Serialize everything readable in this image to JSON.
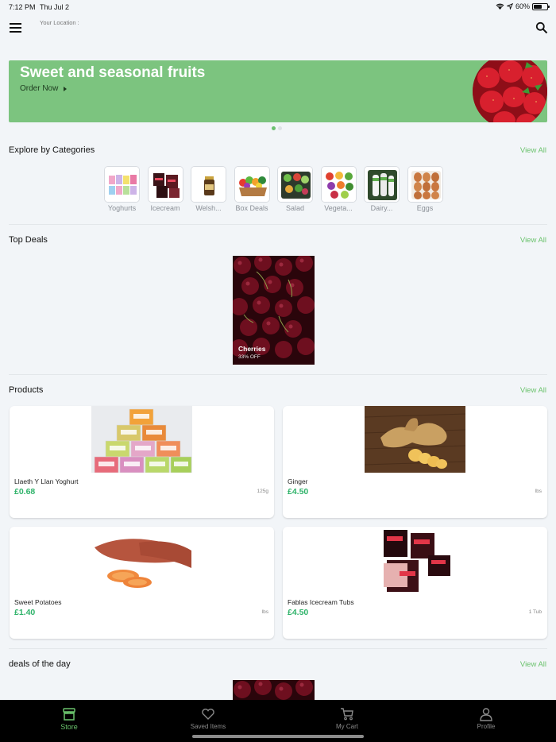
{
  "status_bar": {
    "time": "7:12 PM",
    "date": "Thu Jul 2",
    "battery": "60%",
    "battery_level": 0.6
  },
  "header": {
    "location_label": "Your Location :"
  },
  "banner": {
    "title": "Sweet and seasonal fruits",
    "cta": "Order Now",
    "slides": 2,
    "active_slide": 1
  },
  "categories": {
    "title": "Explore by Categories",
    "view_all": "View All",
    "items": [
      {
        "label": "Yoghurts"
      },
      {
        "label": "Icecream"
      },
      {
        "label": "Welsh..."
      },
      {
        "label": "Box Deals"
      },
      {
        "label": "Salad"
      },
      {
        "label": "Vegeta..."
      },
      {
        "label": "Dairy..."
      },
      {
        "label": "Eggs"
      }
    ]
  },
  "top_deals": {
    "title": "Top Deals",
    "view_all": "View All",
    "items": [
      {
        "name": "Cherries",
        "discount": "33% OFF"
      }
    ]
  },
  "products": {
    "title": "Products",
    "view_all": "View All",
    "items": [
      {
        "name": "Llaeth Y Llan Yoghurt",
        "price": "£0.68",
        "unit": "125g"
      },
      {
        "name": "Ginger",
        "price": "£4.50",
        "unit": "lbs"
      },
      {
        "name": "Sweet Potatoes",
        "price": "£1.40",
        "unit": "lbs"
      },
      {
        "name": "Fablas Icecream Tubs",
        "price": "£4.50",
        "unit": "1 Tub"
      }
    ]
  },
  "deals_of_day": {
    "title": "deals of the day",
    "view_all": "View All"
  },
  "tabs": [
    {
      "label": "Store",
      "icon": "store-icon",
      "active": true
    },
    {
      "label": "Saved Items",
      "icon": "heart-icon",
      "active": false
    },
    {
      "label": "My Cart",
      "icon": "cart-icon",
      "active": false
    },
    {
      "label": "Profile",
      "icon": "person-icon",
      "active": false
    }
  ],
  "colors": {
    "accent": "#6ac26c",
    "banner": "#7cc47f",
    "price": "#2fb36a",
    "tab_bar": "#000000"
  }
}
